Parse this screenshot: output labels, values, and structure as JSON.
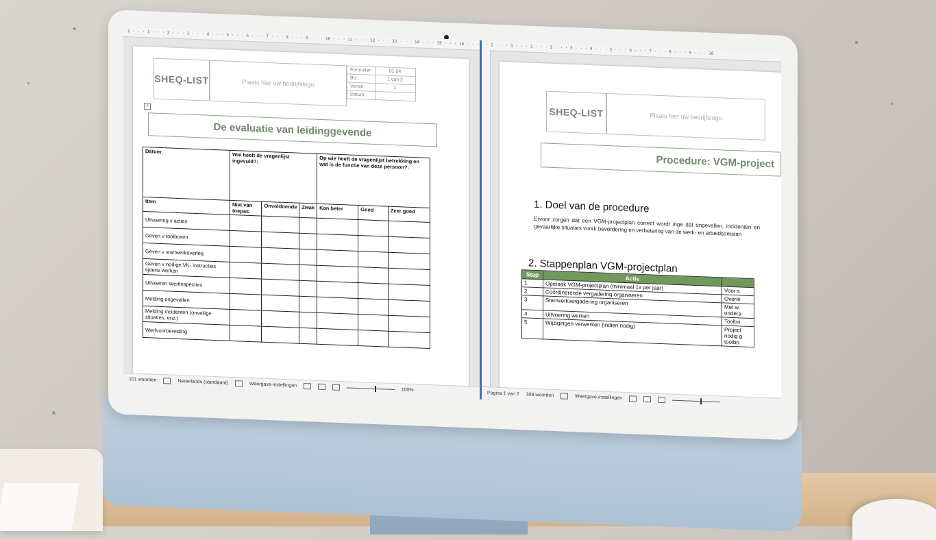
{
  "left_doc": {
    "logo": "SHEQ-LIST",
    "logo_placeholder": "Plaats hier uw bedrijfslogo",
    "meta": [
      {
        "label": "Formulier:",
        "value": "01.04"
      },
      {
        "label": "Blz.:",
        "value": "1 van 2"
      },
      {
        "label": "Versie:",
        "value": "1"
      },
      {
        "label": "Datum:",
        "value": ""
      }
    ],
    "title": "De evaluatie van leidinggevende",
    "table": {
      "datum": "Datum:",
      "wie": "Wie heeft de vragenlijst ingevuld?:",
      "op_wie": "Op wie heeft de vragenlijst betrekking en wat is de functie van deze persoon?:",
      "columns": [
        "Item",
        "Niet van toepas.",
        "Onvoldoende",
        "Zwak",
        "Kan beter",
        "Goed",
        "Zeer goed"
      ],
      "rows": [
        "Uitvoering v acties",
        "Geven v toolboxen",
        "Geven v startwerkoverleg",
        "Geven v nodige VK- instructies tijdens werken",
        "Uitvoeren Werfinspecties",
        "Melding ongevallen",
        "Melding incidenten (onveilige situaties, enz.)",
        "Werfvoorbereiding"
      ]
    },
    "status": {
      "words": "101 woorden",
      "language": "Nederlands (standaard)",
      "view_settings": "Weergave-instellingen",
      "zoom": "100%"
    }
  },
  "right_doc": {
    "logo": "SHEQ-LIST",
    "logo_placeholder": "Plaats hier uw bedrijfslogo",
    "title": "Procedure: VGM-project",
    "section1_title": "1. Doel van de procedure",
    "section1_text": "Ervoor zorgen dat een VGM-projectplan correct wordt inge dat ongevallen, incidenten en gevaarlijke situaties voork bevordering en verbetering van de werk- en arbeidsomstan",
    "section2_title": "2. Stappenplan VGM-projectplan",
    "steps_header": [
      "Stap",
      "Actie",
      ""
    ],
    "steps": [
      {
        "nr": "1",
        "action": "Opmaak VGM-projectplan (minimaal 1x per jaar)",
        "note": "Voor s"
      },
      {
        "nr": "2",
        "action": "Coördinerende vergadering organiseren",
        "note": "Overle"
      },
      {
        "nr": "3",
        "action": "Startwerkvergadering organiseren",
        "note": "Met w ondera"
      },
      {
        "nr": "4",
        "action": "Uitvoering werken",
        "note": "Toolbo"
      },
      {
        "nr": "5",
        "action": "Wijzigingen verwerken (indien nodig)",
        "note": "Project nodig g toolbo"
      }
    ],
    "status": {
      "page": "Pagina 1 van 2",
      "words": "308 woorden",
      "view_settings": "Weergave-instellingen"
    }
  },
  "ruler_left": "1 · · · 1 · · · 2 · · · 3 · · · 4 · · · 5 · · · 6 · · · 7 · · · 8 · · · 9 · · · 10 · · · 11 · · · 12 · · · 13 · · · 14 · · · 15 · · · 16 · · · 17 · · · 18",
  "ruler_right": "· 2 · · · 1 · · · 1 · · · 2 · · · 3 · · · 4 · · · 5 · · · 6 · · · 7 · · · 8 · · · 9 · · · 10"
}
